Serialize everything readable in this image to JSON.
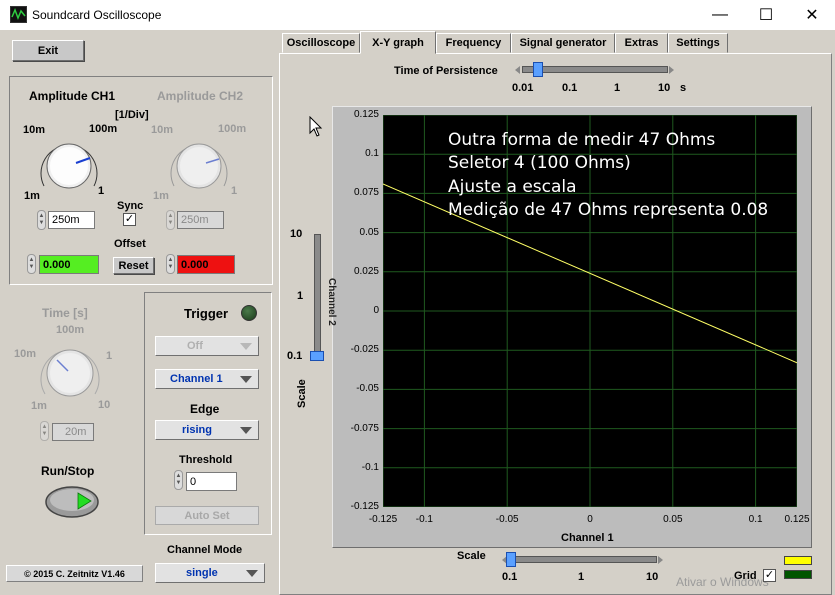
{
  "window": {
    "title": "Soundcard Oscilloscope",
    "minimize_glyph": "—",
    "maximize_glyph": "☐",
    "close_glyph": "✕"
  },
  "left": {
    "exit_label": "Exit",
    "amp_ch1_title": "Amplitude CH1",
    "amp_ch2_title": "Amplitude CH2",
    "amp_unit": "[1/Div]",
    "knob_labels": {
      "top_left": "10m",
      "top_right": "100m",
      "bottom_left": "1m",
      "bottom_right": "1"
    },
    "ch1_value": "250m",
    "ch2_value": "250m",
    "sync_label": "Sync",
    "sync_checked": "✓",
    "offset_label": "Offset",
    "offset_ch1": "0.000",
    "offset_ch2": "0.000",
    "reset_label": "Reset",
    "time_title": "Time [s]",
    "time_labels": {
      "top": "100m",
      "left": "10m",
      "right": "1",
      "bottom_left": "1m",
      "bottom_right": "10"
    },
    "time_value": "20m",
    "runstop_label": "Run/Stop",
    "copyright": "© 2015  C. Zeitnitz V1.46",
    "trigger": {
      "title": "Trigger",
      "mode": "Off",
      "channel": "Channel 1",
      "edge_label": "Edge",
      "edge": "rising",
      "threshold_label": "Threshold",
      "threshold": "0",
      "autoset_label": "Auto Set"
    },
    "channel_mode_label": "Channel Mode",
    "channel_mode": "single"
  },
  "tabs": [
    "Oscilloscope",
    "X-Y graph",
    "Frequency",
    "Signal generator",
    "Extras",
    "Settings"
  ],
  "active_tab": "X-Y graph",
  "persistence": {
    "label": "Time of Persistence",
    "ticks": [
      "0.01",
      "0.1",
      "1",
      "10"
    ],
    "unit": "s"
  },
  "scale_x": {
    "label": "Scale",
    "ticks": [
      "0.1",
      "1",
      "10"
    ]
  },
  "scale_y": {
    "label": "Scale",
    "ticks": [
      "10",
      "1",
      "0.1"
    ]
  },
  "grid": {
    "label": "Grid",
    "checked": "✓",
    "color_ch1": "#ffff00",
    "color_ch2": "#005500"
  },
  "annotations": [
    "Outra forma de medir 47 Ohms",
    "Seletor 4 (100 Ohms)",
    "Ajuste a escala",
    "Medição de 47 Ohms representa 0.08"
  ],
  "watermark": "Ativar o Windows",
  "chart_data": {
    "type": "line",
    "xlabel": "Channel 1",
    "ylabel": "Channel 2",
    "xlim": [
      -0.125,
      0.125
    ],
    "ylim": [
      -0.125,
      0.125
    ],
    "grid": true,
    "x_ticks": [
      "-0.125",
      "-0.1",
      "-0.05",
      "0",
      "0.05",
      "0.1",
      "0.125"
    ],
    "y_ticks": [
      "0.125",
      "0.1",
      "0.075",
      "0.05",
      "0.025",
      "0",
      "-0.025",
      "-0.05",
      "-0.075",
      "-0.1",
      "-0.125"
    ],
    "series": [
      {
        "color": "#ffff66",
        "x": [
          -0.125,
          0.125
        ],
        "y": [
          0.081,
          -0.033
        ]
      }
    ]
  }
}
